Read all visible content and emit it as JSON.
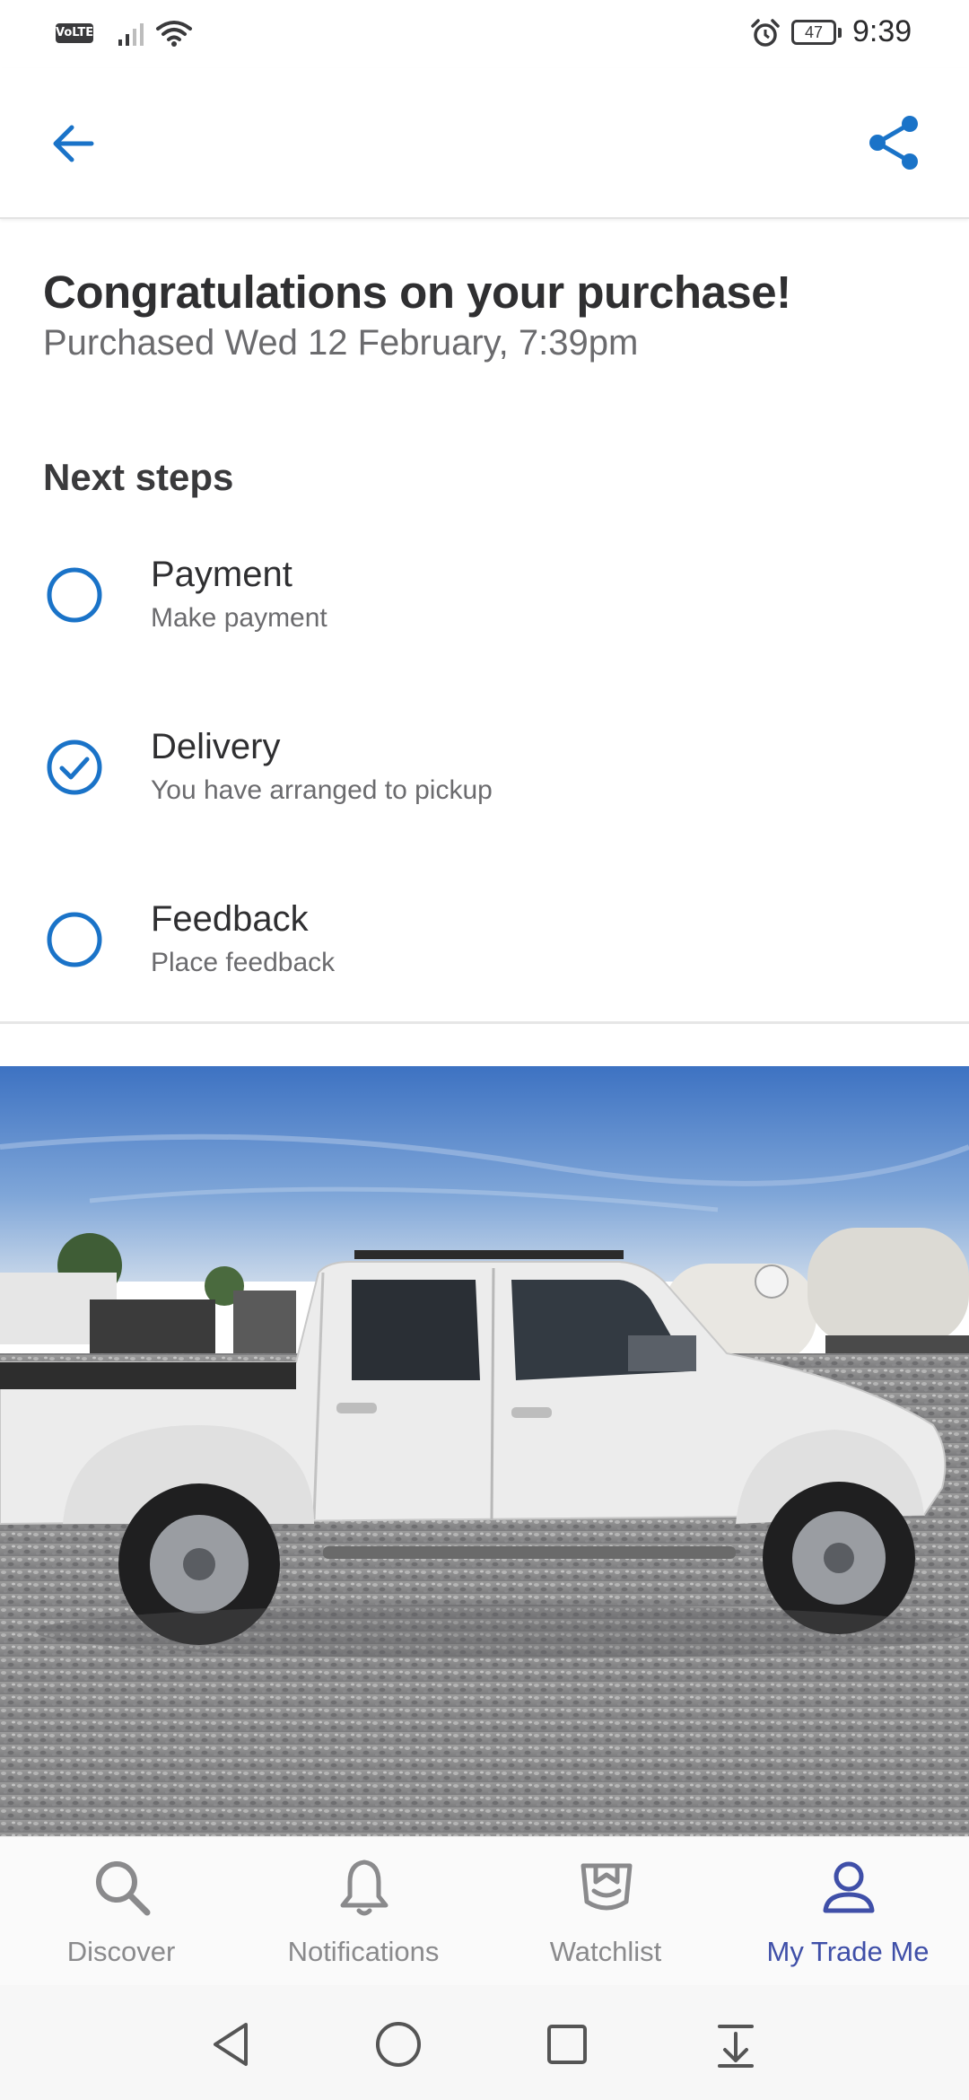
{
  "status_bar": {
    "network_badge": "VoLTE",
    "battery": "47",
    "time": "9:39"
  },
  "app_bar": {
    "back_icon": "arrow-left-icon",
    "share_icon": "share-icon",
    "accent_color": "#1a73c8"
  },
  "purchase": {
    "title": "Congratulations on your purchase!",
    "purchased_on": "Purchased Wed 12 February, 7:39pm"
  },
  "next_steps": {
    "heading": "Next steps",
    "items": [
      {
        "label": "Payment",
        "sublabel": "Make payment",
        "completed": false
      },
      {
        "label": "Delivery",
        "sublabel": "You have arranged to pickup",
        "completed": true
      },
      {
        "label": "Feedback",
        "sublabel": "Place feedback",
        "completed": false
      }
    ]
  },
  "listing_photo": {
    "subject": "white double-cab ute parked on gravel"
  },
  "bottom_nav": {
    "active_color": "#3f4fa8",
    "inactive_color": "#8a8a8c",
    "items": [
      {
        "label": "Discover",
        "icon": "search-icon",
        "active": false
      },
      {
        "label": "Notifications",
        "icon": "bell-icon",
        "active": false
      },
      {
        "label": "Watchlist",
        "icon": "watchlist-icon",
        "active": false
      },
      {
        "label": "My Trade Me",
        "icon": "user-icon",
        "active": true
      }
    ]
  },
  "system_nav": {
    "items": [
      "back-triangle-icon",
      "home-circle-icon",
      "recents-square-icon",
      "notification-shade-icon"
    ]
  }
}
